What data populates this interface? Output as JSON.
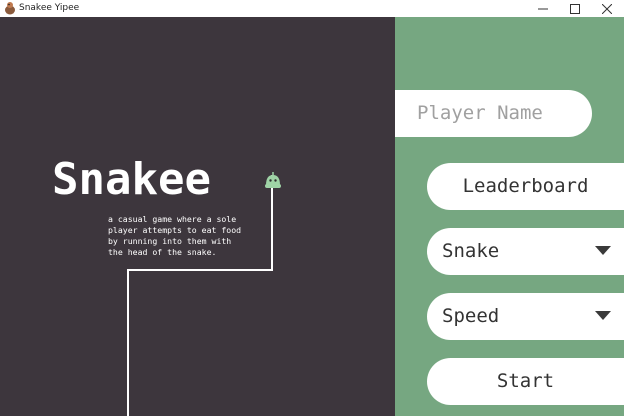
{
  "window": {
    "title": "Snakee Yipee",
    "controls": [
      "minimize",
      "maximize",
      "close"
    ]
  },
  "game": {
    "title": "Snakee",
    "description": "a casual game where a sole\nplayer attempts to eat food\nby running into them with\nthe head of the snake."
  },
  "menu": {
    "player_name_placeholder": "Player Name",
    "leaderboard_label": "Leaderboard",
    "snake_select_value": "Snake",
    "speed_select_value": "Speed",
    "start_label": "Start"
  },
  "colors": {
    "left_background": "#3d363d",
    "right_background": "#76a781",
    "snake_head": "#9fd3a6",
    "button_background": "#ffffff"
  }
}
